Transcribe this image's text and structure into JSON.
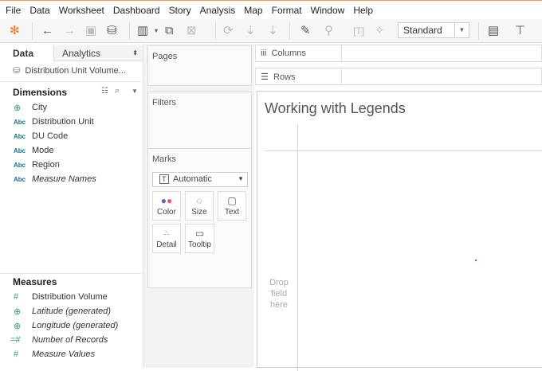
{
  "menu": [
    "File",
    "Data",
    "Worksheet",
    "Dashboard",
    "Story",
    "Analysis",
    "Map",
    "Format",
    "Window",
    "Help"
  ],
  "toolbar": {
    "fit_select": "Standard"
  },
  "left_panel": {
    "tab_data": "Data",
    "tab_analytics": "Analytics",
    "datasource": "Distribution Unit Volume...",
    "dimensions_header": "Dimensions",
    "dimensions": [
      {
        "type": "Abc",
        "label": "City",
        "icon": "globe-icon"
      },
      {
        "type": "Abc",
        "label": "Distribution Unit"
      },
      {
        "type": "Abc",
        "label": "DU Code"
      },
      {
        "type": "Abc",
        "label": "Mode"
      },
      {
        "type": "Abc",
        "label": "Region"
      },
      {
        "type": "Abc",
        "label": "Measure Names"
      }
    ],
    "measures_header": "Measures",
    "measures": [
      {
        "label": "Distribution Volume",
        "icon": "#"
      },
      {
        "label": "Latitude (generated)",
        "icon": "globe"
      },
      {
        "label": "Longitude (generated)",
        "icon": "globe"
      },
      {
        "label": "Number of Records",
        "icon": "=#"
      },
      {
        "label": "Measure Values",
        "icon": "#"
      }
    ]
  },
  "cards": {
    "pages": "Pages",
    "filters": "Filters",
    "marks": "Marks",
    "mark_type": "Automatic",
    "color": "Color",
    "size": "Size",
    "text": "Text",
    "detail": "Detail",
    "tooltip": "Tooltip"
  },
  "shelves": {
    "columns": "Columns",
    "rows": "Rows"
  },
  "viz": {
    "title": "Working with Legends",
    "drop1": "Drop",
    "drop2": "field",
    "drop3": "here"
  }
}
